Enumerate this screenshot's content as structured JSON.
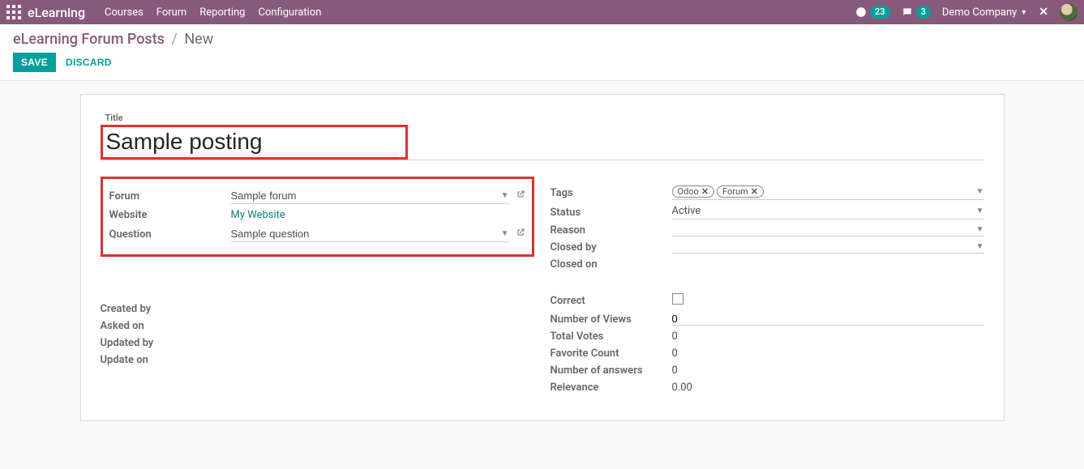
{
  "navbar": {
    "brand": "eLearning",
    "menu": [
      "Courses",
      "Forum",
      "Reporting",
      "Configuration"
    ],
    "activity_count": "23",
    "message_count": "3",
    "company": "Demo Company"
  },
  "breadcrumb": {
    "root": "eLearning Forum Posts",
    "current": "New"
  },
  "actions": {
    "save": "SAVE",
    "discard": "DISCARD"
  },
  "form": {
    "title_label": "Title",
    "title_value": "Sample posting",
    "left": {
      "forum_label": "Forum",
      "forum_value": "Sample forum",
      "website_label": "Website",
      "website_value": "My Website",
      "question_label": "Question",
      "question_value": "Sample question",
      "created_by_label": "Created by",
      "asked_on_label": "Asked on",
      "updated_by_label": "Updated by",
      "update_on_label": "Update on"
    },
    "right": {
      "tags_label": "Tags",
      "tags": [
        "Odoo",
        "Forum"
      ],
      "status_label": "Status",
      "status_value": "Active",
      "reason_label": "Reason",
      "closed_by_label": "Closed by",
      "closed_on_label": "Closed on",
      "correct_label": "Correct",
      "views_label": "Number of Views",
      "views_value": "0",
      "votes_label": "Total Votes",
      "votes_value": "0",
      "fav_label": "Favorite Count",
      "fav_value": "0",
      "answers_label": "Number of answers",
      "answers_value": "0",
      "relevance_label": "Relevance",
      "relevance_value": "0.00"
    }
  }
}
